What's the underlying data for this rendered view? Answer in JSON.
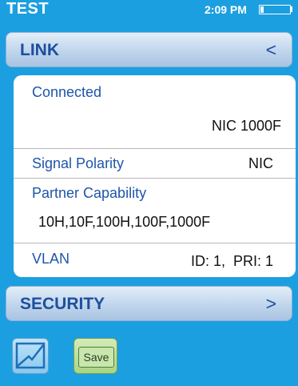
{
  "status": {
    "title": "TEST",
    "time": "2:09 PM",
    "battery_level": 0.1
  },
  "link_section": {
    "title": "LINK",
    "chevron": "<"
  },
  "details": {
    "connected_label": "Connected",
    "connected_value": "NIC 1000F",
    "signal_polarity_label": "Signal Polarity",
    "signal_polarity_value": "NIC",
    "partner_capability_label": "Partner Capability",
    "partner_capability_value": "10H,10F,100H,100F,1000F",
    "vlan_label": "VLAN",
    "vlan_value": "ID: 1,  PRI: 1"
  },
  "security_section": {
    "title": "SECURITY",
    "chevron": ">"
  },
  "toolbar": {
    "chart_icon": "chart-icon",
    "save_label": "Save"
  },
  "colors": {
    "background": "#1c9fe0",
    "label_blue": "#1f55a8",
    "header_text": "#1d4f9e"
  }
}
